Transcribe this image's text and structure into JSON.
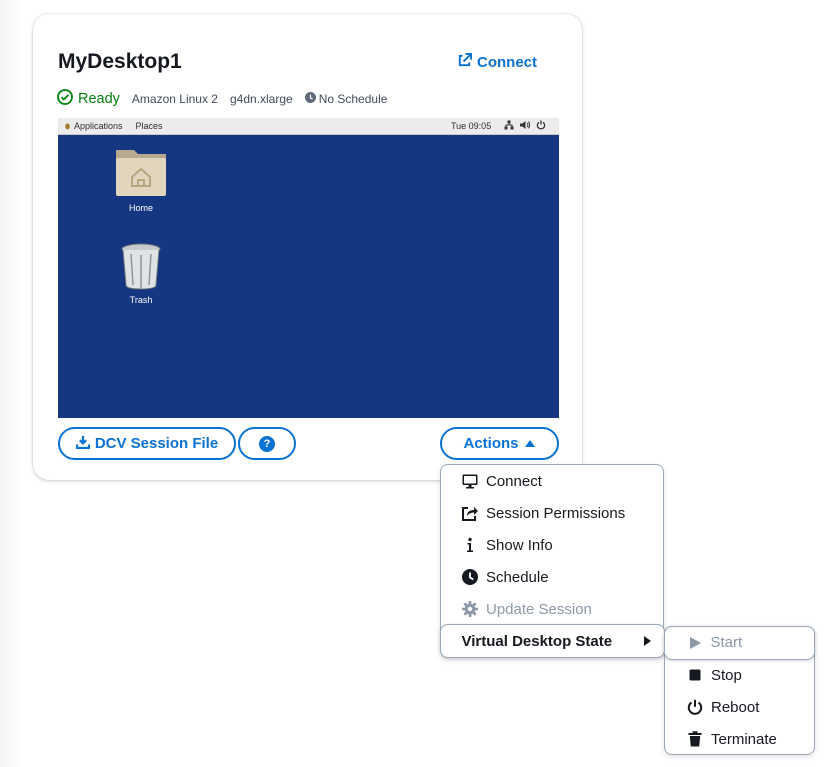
{
  "desktop": {
    "name": "MyDesktop1",
    "connect_label": "Connect",
    "status": "Ready",
    "os": "Amazon Linux 2",
    "instance_type": "g4dn.xlarge",
    "schedule": "No Schedule"
  },
  "screenshot": {
    "menu_applications": "Applications",
    "menu_places": "Places",
    "clock": "Tue 09:05",
    "icons": [
      {
        "label": "Home",
        "icon": "home-folder-icon"
      },
      {
        "label": "Trash",
        "icon": "trash-icon"
      }
    ],
    "colors": {
      "desktop_bg": "#153680"
    }
  },
  "buttons": {
    "dcv_session_file": "DCV Session File",
    "help": "?",
    "actions": "Actions"
  },
  "actions_menu": {
    "items": [
      {
        "label": "Connect",
        "icon": "monitor-icon",
        "disabled": false
      },
      {
        "label": "Session Permissions",
        "icon": "share-icon",
        "disabled": false
      },
      {
        "label": "Show Info",
        "icon": "info-icon",
        "disabled": false
      },
      {
        "label": "Schedule",
        "icon": "clock-icon",
        "disabled": false
      },
      {
        "label": "Update Session",
        "icon": "gear-icon",
        "disabled": true
      }
    ],
    "submenu_label": "Virtual Desktop State"
  },
  "state_menu": {
    "items": [
      {
        "label": "Start",
        "icon": "play-icon",
        "disabled": true
      },
      {
        "label": "Stop",
        "icon": "stop-icon",
        "disabled": false
      },
      {
        "label": "Reboot",
        "icon": "power-icon",
        "disabled": false
      },
      {
        "label": "Terminate",
        "icon": "trash-icon",
        "disabled": false
      }
    ]
  },
  "colors": {
    "accent": "#0972d3",
    "success": "#037f0c",
    "disabled": "#8d99a8"
  }
}
